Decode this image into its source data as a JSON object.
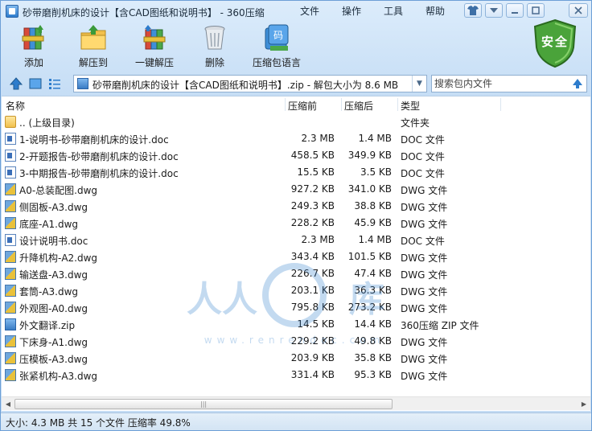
{
  "window": {
    "title": "砂带磨削机床的设计【含CAD图纸和说明书】 - 360压缩",
    "menu": [
      "文件",
      "操作",
      "工具",
      "帮助"
    ]
  },
  "toolbar": {
    "buttons": [
      {
        "label": "添加",
        "icon": "add-books-icon"
      },
      {
        "label": "解压到",
        "icon": "extract-to-folder-icon"
      },
      {
        "label": "一键解压",
        "icon": "one-click-extract-icon"
      },
      {
        "label": "删除",
        "icon": "trash-can-icon"
      },
      {
        "label": "压缩包语言",
        "icon": "archive-language-icon"
      }
    ],
    "security_badge": "安全"
  },
  "address": {
    "path": "砂带磨削机床的设计【含CAD图纸和说明书】.zip - 解包大小为 8.6 MB",
    "search_placeholder": "搜索包内文件"
  },
  "columns": {
    "name": "名称",
    "compressed": "压缩前",
    "original": "压缩后",
    "type": "类型"
  },
  "files": [
    {
      "name": ".. (上级目录)",
      "compressed": "",
      "original": "",
      "type": "文件夹",
      "icon": "folder"
    },
    {
      "name": "1-说明书-砂带磨削机床的设计.doc",
      "compressed": "2.3 MB",
      "original": "1.4 MB",
      "type": "DOC 文件",
      "icon": "doc"
    },
    {
      "name": "2-开题报告-砂带磨削机床的设计.doc",
      "compressed": "458.5 KB",
      "original": "349.9 KB",
      "type": "DOC 文件",
      "icon": "doc"
    },
    {
      "name": "3-中期报告-砂带磨削机床的设计.doc",
      "compressed": "15.5 KB",
      "original": "3.5 KB",
      "type": "DOC 文件",
      "icon": "doc"
    },
    {
      "name": "A0-总装配图.dwg",
      "compressed": "927.2 KB",
      "original": "341.0 KB",
      "type": "DWG 文件",
      "icon": "dwg"
    },
    {
      "name": "侧固板-A3.dwg",
      "compressed": "249.3 KB",
      "original": "38.8 KB",
      "type": "DWG 文件",
      "icon": "dwg"
    },
    {
      "name": "底座-A1.dwg",
      "compressed": "228.2 KB",
      "original": "45.9 KB",
      "type": "DWG 文件",
      "icon": "dwg"
    },
    {
      "name": "设计说明书.doc",
      "compressed": "2.3 MB",
      "original": "1.4 MB",
      "type": "DOC 文件",
      "icon": "doc"
    },
    {
      "name": "升降机构-A2.dwg",
      "compressed": "343.4 KB",
      "original": "101.5 KB",
      "type": "DWG 文件",
      "icon": "dwg"
    },
    {
      "name": "输送盘-A3.dwg",
      "compressed": "226.7 KB",
      "original": "47.4 KB",
      "type": "DWG 文件",
      "icon": "dwg"
    },
    {
      "name": "套筒-A3.dwg",
      "compressed": "203.1 KB",
      "original": "36.3 KB",
      "type": "DWG 文件",
      "icon": "dwg"
    },
    {
      "name": "外观图-A0.dwg",
      "compressed": "795.8 KB",
      "original": "273.2 KB",
      "type": "DWG 文件",
      "icon": "dwg"
    },
    {
      "name": "外文翻译.zip",
      "compressed": "14.5 KB",
      "original": "14.4 KB",
      "type": "360压缩 ZIP 文件",
      "icon": "zip"
    },
    {
      "name": "下床身-A1.dwg",
      "compressed": "229.2 KB",
      "original": "49.8 KB",
      "type": "DWG 文件",
      "icon": "dwg"
    },
    {
      "name": "压模板-A3.dwg",
      "compressed": "203.9 KB",
      "original": "35.8 KB",
      "type": "DWG 文件",
      "icon": "dwg"
    },
    {
      "name": "张紧机构-A3.dwg",
      "compressed": "331.4 KB",
      "original": "95.3 KB",
      "type": "DWG 文件",
      "icon": "dwg"
    }
  ],
  "watermark": {
    "text": "人人文库",
    "url": "www.renrendoc.com"
  },
  "status": {
    "text": "大小: 4.3 MB 共 15 个文件 压缩率 49.8%"
  },
  "colors": {
    "accent": "#2d7ccc",
    "shield": "#3f9a2f",
    "folder": "#f2c04c"
  }
}
